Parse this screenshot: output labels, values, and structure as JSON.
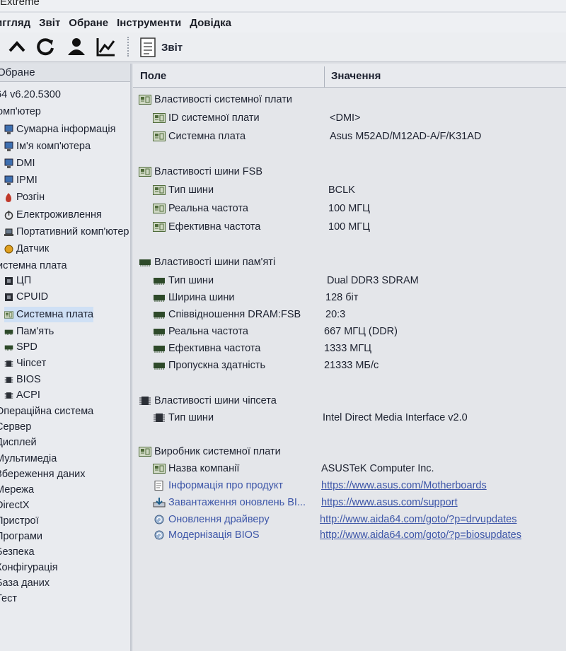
{
  "window": {
    "title_fragment": "Extreme"
  },
  "menu": [
    "иггляд",
    "Звіт",
    "Обране",
    "Інструменти",
    "Довідка"
  ],
  "toolbar": {
    "buttons": [
      "arrow-up-icon",
      "refresh-icon",
      "user-icon",
      "chart-icon"
    ],
    "report_label": "Звіт"
  },
  "sidebar": {
    "header": "Обране",
    "items": [
      {
        "label": "64 v6.20.5300",
        "icon": "none"
      },
      {
        "label": "омп'ютер",
        "icon": "none"
      },
      {
        "label": "Сумарна інформація",
        "icon": "computer-icon"
      },
      {
        "label": "Ім'я комп'ютера",
        "icon": "computer-icon"
      },
      {
        "label": "DMI",
        "icon": "computer-icon"
      },
      {
        "label": "IPMI",
        "icon": "computer-icon"
      },
      {
        "label": "Розгін",
        "icon": "flame-icon"
      },
      {
        "label": "Електроживлення",
        "icon": "power-icon"
      },
      {
        "label": "Портативний комп'ютер",
        "icon": "laptop-icon"
      },
      {
        "label": "Датчик",
        "icon": "sensor-icon"
      },
      {
        "label": "истемна плата",
        "icon": "none"
      },
      {
        "label": "ЦП",
        "icon": "cpu-icon"
      },
      {
        "label": "CPUID",
        "icon": "cpu-icon"
      },
      {
        "label": "Системна плата",
        "icon": "board-icon"
      },
      {
        "label": "Пам'ять",
        "icon": "memory-icon"
      },
      {
        "label": "SPD",
        "icon": "memory-icon"
      },
      {
        "label": "Чіпсет",
        "icon": "chip-icon"
      },
      {
        "label": "BIOS",
        "icon": "chip-icon"
      },
      {
        "label": "ACPI",
        "icon": "chip-icon"
      },
      {
        "label": "Операційна система",
        "icon": "none"
      },
      {
        "label": "Сервер",
        "icon": "none"
      },
      {
        "label": "Дисплей",
        "icon": "none"
      },
      {
        "label": "Мультимедіа",
        "icon": "none"
      },
      {
        "label": "Збереження даних",
        "icon": "none"
      },
      {
        "label": "Мережа",
        "icon": "none"
      },
      {
        "label": "DirectX",
        "icon": "none"
      },
      {
        "label": "Пристрої",
        "icon": "none"
      },
      {
        "label": "Програми",
        "icon": "none"
      },
      {
        "label": "Безпека",
        "icon": "none"
      },
      {
        "label": "Конфігурація",
        "icon": "none"
      },
      {
        "label": "База даних",
        "icon": "none"
      },
      {
        "label": "Тест",
        "icon": "none"
      }
    ],
    "selected": "Системна плата"
  },
  "table": {
    "col_field": "Поле",
    "col_value": "Значення",
    "rows": [
      {
        "kind": "group",
        "icon": "board-icon",
        "field": "Властивості системної плати",
        "value": ""
      },
      {
        "kind": "item",
        "icon": "board-icon",
        "field": "ID системної плати",
        "value": "<DMI>"
      },
      {
        "kind": "item",
        "icon": "board-icon",
        "field": "Системна плата",
        "value": "Asus M52AD/M12AD-A/F/K31AD"
      },
      {
        "kind": "group",
        "icon": "board-icon",
        "field": "Властивості шини FSB",
        "value": ""
      },
      {
        "kind": "item",
        "icon": "board-icon",
        "field": "Тип шини",
        "value": "BCLK"
      },
      {
        "kind": "item",
        "icon": "board-icon",
        "field": "Реальна частота",
        "value": "100 МГЦ"
      },
      {
        "kind": "item",
        "icon": "board-icon",
        "field": "Ефективна частота",
        "value": "100 МГЦ"
      },
      {
        "kind": "group",
        "icon": "memory-icon",
        "field": "Властивості шини пам'яті",
        "value": ""
      },
      {
        "kind": "item",
        "icon": "memory-icon",
        "field": "Тип шини",
        "value": "Dual DDR3 SDRAM"
      },
      {
        "kind": "item",
        "icon": "memory-icon",
        "field": "Ширина шини",
        "value": "128 біт"
      },
      {
        "kind": "item",
        "icon": "memory-icon",
        "field": "Співвідношення DRAM:FSB",
        "value": "20:3"
      },
      {
        "kind": "item",
        "icon": "memory-icon",
        "field": "Реальна частота",
        "value": "667 МГЦ (DDR)"
      },
      {
        "kind": "item",
        "icon": "memory-icon",
        "field": "Ефективна частота",
        "value": "1333 МГЦ"
      },
      {
        "kind": "item",
        "icon": "memory-icon",
        "field": "Пропускна здатність",
        "value": "21333 МБ/с"
      },
      {
        "kind": "group",
        "icon": "chip-icon",
        "field": "Властивості шини чіпсета",
        "value": ""
      },
      {
        "kind": "item",
        "icon": "chip-icon",
        "field": "Тип шини",
        "value": "Intel Direct Media Interface v2.0"
      },
      {
        "kind": "group",
        "icon": "board-icon",
        "field": "Виробник системної плати",
        "value": ""
      },
      {
        "kind": "item",
        "icon": "board-icon",
        "field": "Назва компанії",
        "value": "ASUSTeK Computer Inc."
      },
      {
        "kind": "link",
        "icon": "document-icon",
        "field": "Інформація про продукт",
        "value": "https://www.asus.com/Motherboards"
      },
      {
        "kind": "link",
        "icon": "download-icon",
        "field": "Завантаження оновлень BI...",
        "value": "https://www.asus.com/support"
      },
      {
        "kind": "link",
        "icon": "update-icon",
        "field": "Оновлення драйверу",
        "value": "http://www.aida64.com/goto/?p=drvupdates"
      },
      {
        "kind": "link",
        "icon": "update-icon",
        "field": "Модернізація BIOS",
        "value": "http://www.aida64.com/goto/?p=biosupdates"
      }
    ]
  },
  "colors": {
    "link": "#3d56a8",
    "selection": "#cfe0f5",
    "board_icon": "#4f6b3a",
    "memory_icon": "#2e4a2a"
  }
}
